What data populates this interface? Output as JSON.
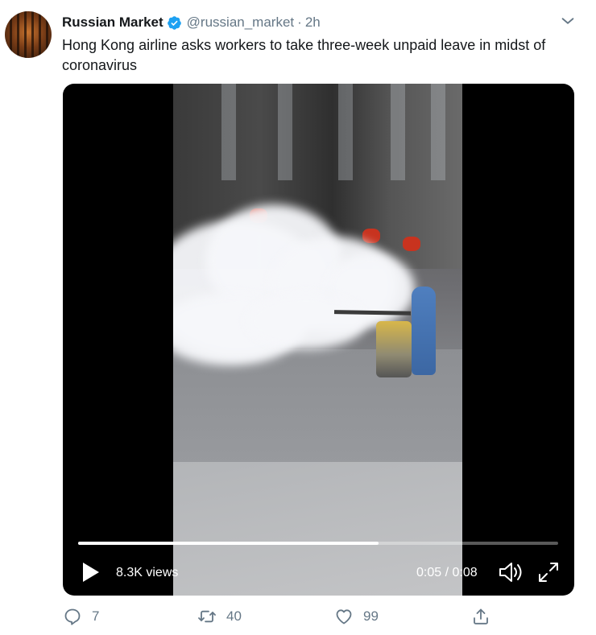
{
  "tweet": {
    "name": "Russian Market",
    "handle": "@russian_market",
    "separator": "·",
    "time": "2h",
    "text": "Hong Kong airline asks workers to take three-week unpaid leave in midst of coronavirus"
  },
  "video": {
    "views": "8.3K views",
    "timecode": "0:05 / 0:08",
    "progress": 0.625
  },
  "actions": {
    "reply_count": "7",
    "retweet_count": "40",
    "like_count": "99"
  },
  "icons": {
    "verified": "verified-badge-icon",
    "caret": "chevron-down-icon",
    "play": "play-icon",
    "sound": "speaker-icon",
    "fullscreen": "fullscreen-icon",
    "reply": "reply-icon",
    "retweet": "retweet-icon",
    "like": "heart-icon",
    "share": "share-icon"
  },
  "colors": {
    "verified": "#1da1f2",
    "muted_text": "#657786",
    "primary_text": "#14171a"
  }
}
